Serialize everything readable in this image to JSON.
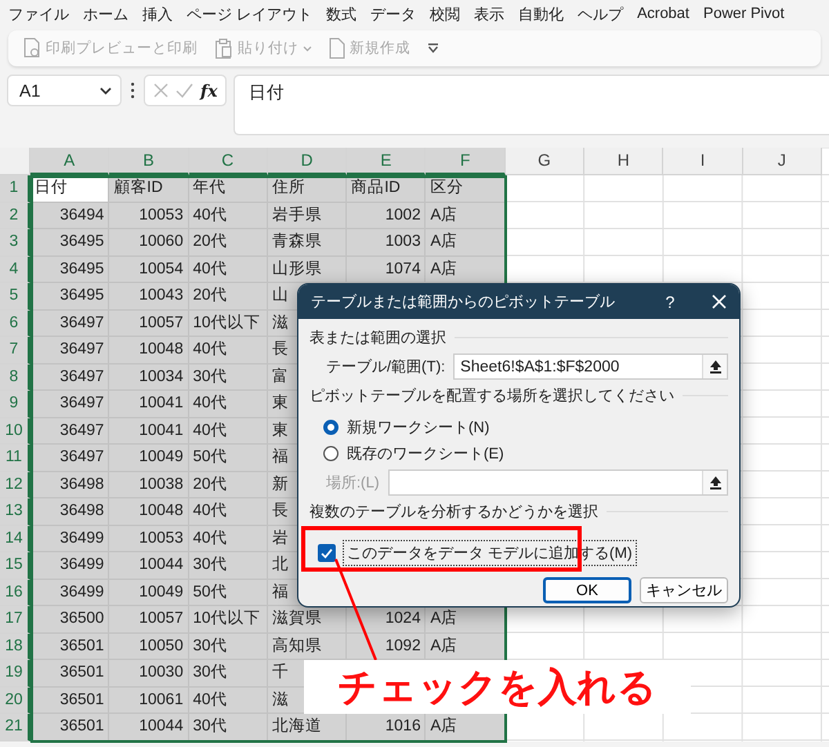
{
  "menu_tabs": [
    "ファイル",
    "ホーム",
    "挿入",
    "ページ レイアウト",
    "数式",
    "データ",
    "校閲",
    "表示",
    "自動化",
    "ヘルプ",
    "Acrobat",
    "Power Pivot"
  ],
  "quick_access": [
    {
      "kind": "print",
      "label": "印刷プレビューと印刷",
      "dropdown": false
    },
    {
      "kind": "paste",
      "label": "貼り付け",
      "dropdown": true
    },
    {
      "kind": "new",
      "label": "新規作成",
      "dropdown": false
    }
  ],
  "name_box": {
    "value": "A1"
  },
  "function_label": "fx",
  "formula": {
    "value": "日付"
  },
  "sheet": {
    "columns": [
      {
        "label": "A",
        "selected": true,
        "numeric": true
      },
      {
        "label": "B",
        "selected": true,
        "numeric": true
      },
      {
        "label": "C",
        "selected": true,
        "numeric": false
      },
      {
        "label": "D",
        "selected": true,
        "numeric": false
      },
      {
        "label": "E",
        "selected": true,
        "numeric": true
      },
      {
        "label": "F",
        "selected": true,
        "numeric": false
      },
      {
        "label": "G",
        "selected": false
      },
      {
        "label": "H",
        "selected": false
      },
      {
        "label": "I",
        "selected": false
      },
      {
        "label": "J",
        "selected": false
      }
    ],
    "header_row": {
      "number": "1",
      "selected": true,
      "cells": [
        {
          "text": "日付",
          "active": true
        },
        {
          "text": "顧客ID",
          "active": false
        },
        {
          "text": "年代",
          "active": false
        },
        {
          "text": "住所",
          "active": false
        },
        {
          "text": "商品ID",
          "active": false
        },
        {
          "text": "区分",
          "active": false
        }
      ]
    },
    "rows": [
      {
        "number": "2",
        "selected": true,
        "cells": [
          "36494",
          "10053",
          "40代",
          "岩手県",
          "1002",
          "A店"
        ]
      },
      {
        "number": "3",
        "selected": true,
        "cells": [
          "36495",
          "10060",
          "20代",
          "青森県",
          "1003",
          "A店"
        ]
      },
      {
        "number": "4",
        "selected": true,
        "cells": [
          "36495",
          "10054",
          "40代",
          "山形県",
          "1074",
          "A店"
        ]
      },
      {
        "number": "5",
        "selected": true,
        "cells": [
          "36495",
          "10043",
          "20代",
          "山",
          null,
          null
        ]
      },
      {
        "number": "6",
        "selected": true,
        "cells": [
          "36497",
          "10057",
          "10代以下",
          "滋",
          null,
          null
        ]
      },
      {
        "number": "7",
        "selected": true,
        "cells": [
          "36497",
          "10048",
          "40代",
          "長",
          null,
          null
        ]
      },
      {
        "number": "8",
        "selected": true,
        "cells": [
          "36497",
          "10034",
          "30代",
          "富",
          null,
          null
        ]
      },
      {
        "number": "9",
        "selected": true,
        "cells": [
          "36497",
          "10041",
          "40代",
          "東",
          null,
          null
        ]
      },
      {
        "number": "10",
        "selected": true,
        "cells": [
          "36497",
          "10041",
          "40代",
          "東",
          null,
          null
        ]
      },
      {
        "number": "11",
        "selected": true,
        "cells": [
          "36497",
          "10049",
          "50代",
          "福",
          null,
          null
        ]
      },
      {
        "number": "12",
        "selected": true,
        "cells": [
          "36498",
          "10038",
          "20代",
          "新",
          null,
          null
        ]
      },
      {
        "number": "13",
        "selected": true,
        "cells": [
          "36498",
          "10048",
          "40代",
          "長",
          null,
          null
        ]
      },
      {
        "number": "14",
        "selected": true,
        "cells": [
          "36499",
          "10053",
          "40代",
          "岩",
          null,
          null
        ]
      },
      {
        "number": "15",
        "selected": true,
        "cells": [
          "36499",
          "10044",
          "30代",
          "北",
          null,
          null
        ]
      },
      {
        "number": "16",
        "selected": true,
        "cells": [
          "36499",
          "10049",
          "50代",
          "福",
          null,
          null
        ]
      },
      {
        "number": "17",
        "selected": true,
        "cells": [
          "36500",
          "10057",
          "10代以下",
          "滋賀県",
          "1024",
          "A店"
        ]
      },
      {
        "number": "18",
        "selected": true,
        "cells": [
          "36501",
          "10050",
          "30代",
          "高知県",
          "1092",
          "A店"
        ]
      },
      {
        "number": "19",
        "selected": true,
        "cells": [
          "36501",
          "10030",
          "30代",
          "千",
          null,
          null
        ]
      },
      {
        "number": "20",
        "selected": true,
        "cells": [
          "36501",
          "10061",
          "40代",
          "滋",
          null,
          null
        ]
      },
      {
        "number": "21",
        "selected": true,
        "cells": [
          "36501",
          "10044",
          "30代",
          "北海道",
          "1016",
          "A店"
        ]
      }
    ]
  },
  "dialog": {
    "title": "テーブルまたは範囲からのピボットテーブル",
    "help": "?",
    "range_section": "表または範囲の選択",
    "range_label": "テーブル/範囲(T):",
    "range_value": "Sheet6!$A$1:$F$2000",
    "placement_section": "ピボットテーブルを配置する場所を選択してください",
    "radios": [
      {
        "label": "新規ワークシート(N)",
        "selected": true
      },
      {
        "label": "既存のワークシート(E)",
        "selected": false
      }
    ],
    "location": {
      "label": "場所:(L)",
      "disabled": true
    },
    "analysis_section": "複数のテーブルを分析するかどうかを選択",
    "checkbox": {
      "label": "このデータをデータ モデルに追加する(M)",
      "checked": true
    },
    "buttons": [
      {
        "label": "OK",
        "default": true
      },
      {
        "label": "キャンセル",
        "default": false
      }
    ]
  },
  "annotation": {
    "text": "チェックを入れる"
  }
}
